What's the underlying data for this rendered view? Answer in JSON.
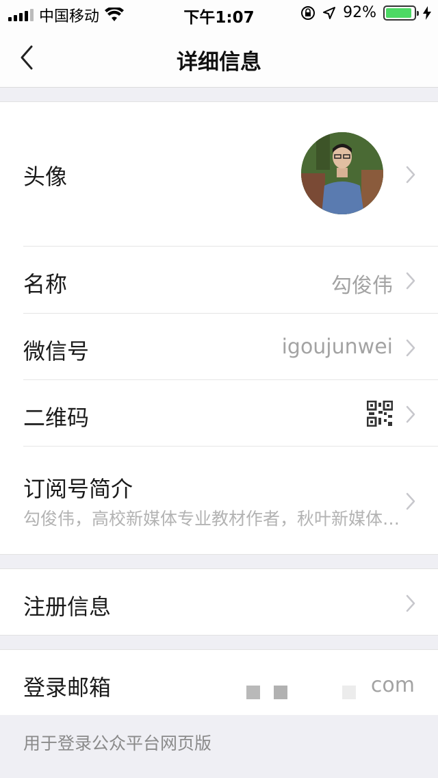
{
  "status": {
    "carrier": "中国移动",
    "time": "下午1:07",
    "battery_percent": "92%",
    "battery_level": 0.92
  },
  "nav": {
    "title": "详细信息"
  },
  "rows": {
    "avatar_label": "头像",
    "name_label": "名称",
    "name_value": "勾俊伟",
    "wechat_label": "微信号",
    "wechat_value": "igoujunwei",
    "qrcode_label": "二维码",
    "intro_label": "订阅号简介",
    "intro_value": "勾俊伟，高校新媒体专业教材作者，秋叶新媒体…",
    "register_label": "注册信息",
    "email_label": "登录邮箱",
    "email_value": "com"
  },
  "footer": {
    "note": "用于登录公众平台网页版"
  },
  "colors": {
    "accent_battery": "#4cd964",
    "background": "#efeff4"
  }
}
